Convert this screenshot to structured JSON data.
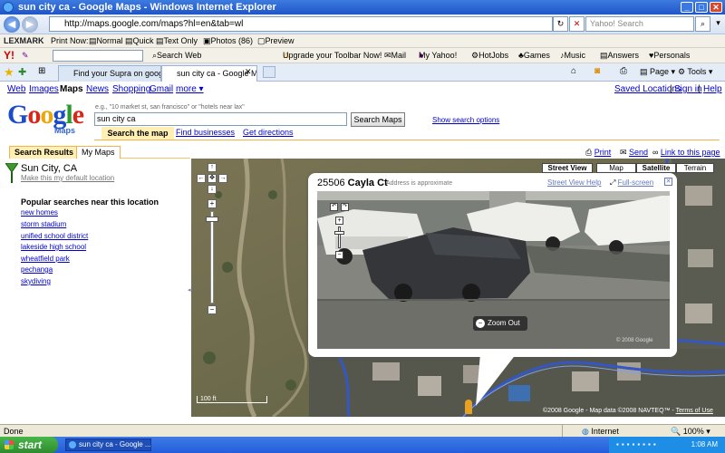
{
  "window": {
    "title": "sun city ca - Google Maps - Windows Internet Explorer"
  },
  "address_bar": {
    "url": "http://maps.google.com/maps?hl=en&tab=wl",
    "search_placeholder": "Yahoo! Search"
  },
  "toolbar_lexmark": {
    "brand": "LEXMARK",
    "print_now": "Print Now:",
    "normal": "Normal",
    "quick": "Quick",
    "text_only": "Text Only",
    "photos": "Photos (86)",
    "preview": "Preview"
  },
  "toolbar_yahoo": {
    "brand": "Y!",
    "search_web": "Search Web",
    "upgrade": "Upgrade your Toolbar Now!",
    "mail": "Mail",
    "my_yahoo": "My Yahoo!",
    "hotjobs": "HotJobs",
    "games": "Games",
    "music": "Music",
    "answers": "Answers",
    "personals": "Personals"
  },
  "tabs": {
    "tab1": "Find your Supra on google m...",
    "tab2": "sun city ca - Google Maps",
    "page_menu": "Page",
    "tools_menu": "Tools"
  },
  "gnav": {
    "web": "Web",
    "images": "Images",
    "maps": "Maps",
    "news": "News",
    "shopping": "Shopping",
    "gmail": "Gmail",
    "more": "more ▾",
    "saved": "Saved Locations",
    "signin": "Sign in",
    "help": "Help",
    "sep": "|"
  },
  "logo": {
    "text": "Google",
    "sub": "Maps"
  },
  "search": {
    "hint": "e.g., \"10 market st, san francisco\" or \"hotels near lax\"",
    "query": "sun city ca",
    "button": "Search Maps",
    "options": "Show search options",
    "tab_map": "Search the map",
    "tab_business": "Find businesses",
    "tab_directions": "Get directions"
  },
  "left_tabs": {
    "results": "Search Results",
    "mymaps": "My Maps"
  },
  "links": {
    "print": "Print",
    "send": "Send",
    "link": "Link to this page"
  },
  "result": {
    "title": "Sun City, CA",
    "default_location": "Make this my default location",
    "popular_title": "Popular searches near this location",
    "popular": [
      "new homes",
      "storm stadium",
      "unified school district",
      "lakeside high school",
      "wheatfield park",
      "pechanga",
      "skydiving"
    ]
  },
  "map_types": {
    "street_view": "Street View",
    "map": "Map",
    "satellite": "Satellite",
    "terrain": "Terrain"
  },
  "streetview": {
    "address_num": "25506",
    "address_street": "Cayla Ct",
    "approx": "Address is approximate",
    "help": "Street View Help",
    "fullscreen": "Full-screen",
    "zoom_out": "Zoom Out",
    "copyright": "© 2008 Google"
  },
  "map_footer": {
    "scale": "100 ft",
    "copyright": "©2008 Google - Map data ©2008 NAVTEQ™ -",
    "terms": "Terms of Use"
  },
  "status": {
    "text": "Done",
    "zone": "Internet",
    "zoom": "100%"
  },
  "taskbar": {
    "start": "start",
    "item": "sun city ca - Google ...",
    "time": "1:08 AM"
  }
}
